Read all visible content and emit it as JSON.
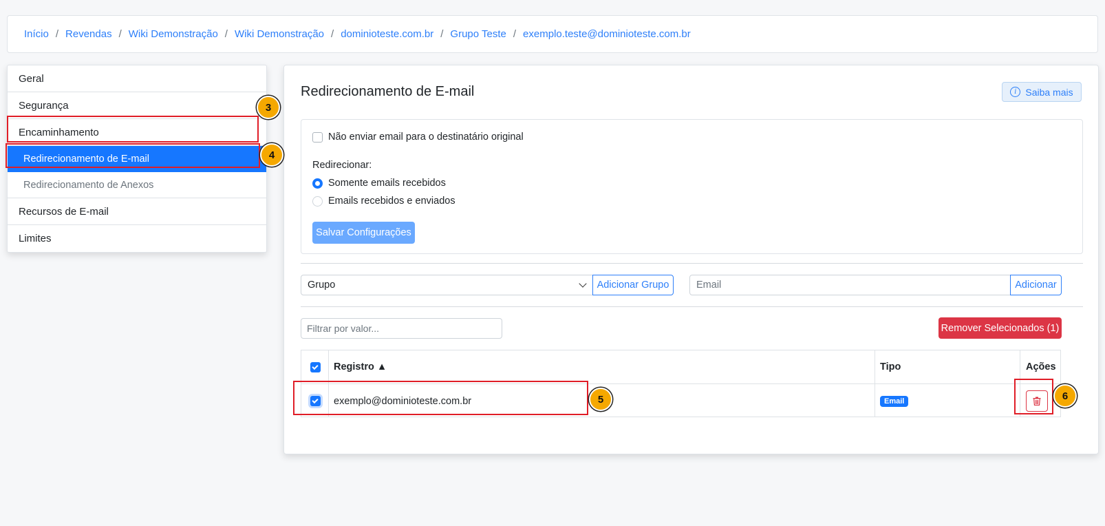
{
  "breadcrumb": [
    "Início",
    "Revendas",
    "Wiki Demonstração",
    "Wiki Demonstração",
    "dominioteste.com.br",
    "Grupo Teste",
    "exemplo.teste@dominioteste.com.br"
  ],
  "breadcrumb_separator": "/",
  "sidebar": {
    "items": [
      {
        "label": "Geral"
      },
      {
        "label": "Segurança"
      },
      {
        "label": "Encaminhamento"
      },
      {
        "label": "Redirecionamento de E-mail"
      },
      {
        "label": "Redirecionamento de Anexos"
      },
      {
        "label": "Recursos de E-mail"
      },
      {
        "label": "Limites"
      }
    ]
  },
  "main": {
    "title": "Redirecionamento de E-mail",
    "help_button": "Saiba mais",
    "help_icon": "i",
    "no_send_checkbox_label": "Não enviar email para o destinatário original",
    "redirect_label": "Redirecionar:",
    "radio_options": [
      "Somente emails recebidos",
      "Emails recebidos e enviados"
    ],
    "save_button": "Salvar Configurações",
    "group_select_value": "Grupo",
    "add_group_button": "Adicionar Grupo",
    "email_placeholder": "Email",
    "add_button": "Adicionar",
    "filter_placeholder": "Filtrar por valor...",
    "remove_selected_button": "Remover Selecionados (1)"
  },
  "table": {
    "headers": {
      "record": "Registro ▲",
      "type": "Tipo",
      "actions": "Ações"
    },
    "rows": [
      {
        "record": "exemplo@dominioteste.com.br",
        "type": "Email"
      }
    ]
  },
  "annotations": [
    "3",
    "4",
    "5",
    "6"
  ],
  "colors": {
    "accent": "#1677ff",
    "danger": "#dc3545",
    "annotation_box": "#e01d27",
    "annotation_badge": "#f5a800"
  }
}
